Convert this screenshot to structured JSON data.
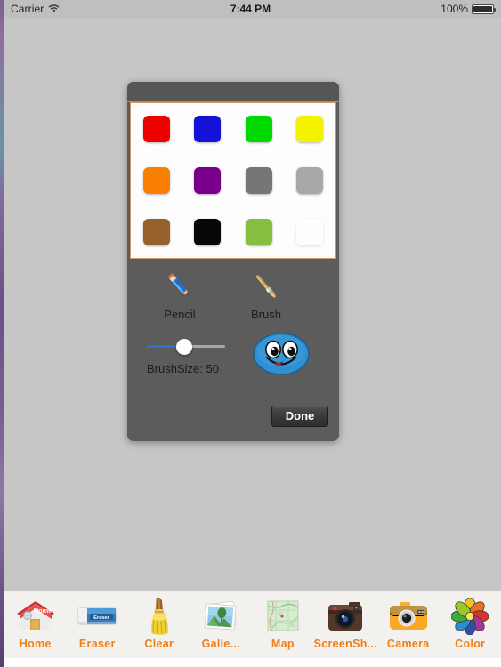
{
  "status_bar": {
    "carrier": "Carrier",
    "wifi_icon": "wifi-icon",
    "time": "7:44 PM",
    "battery_percent": "100%",
    "battery_icon": "battery-full-icon"
  },
  "dialog": {
    "title": "",
    "palette": {
      "swatches": [
        {
          "name": "red",
          "hex": "#ee0000"
        },
        {
          "name": "blue",
          "hex": "#1313d8"
        },
        {
          "name": "green",
          "hex": "#00d900"
        },
        {
          "name": "yellow",
          "hex": "#f3f300"
        },
        {
          "name": "orange",
          "hex": "#f98000"
        },
        {
          "name": "purple",
          "hex": "#7b0089"
        },
        {
          "name": "dark-gray",
          "hex": "#767676"
        },
        {
          "name": "light-gray",
          "hex": "#a8a8a8"
        },
        {
          "name": "brown",
          "hex": "#96602c"
        },
        {
          "name": "black",
          "hex": "#070707"
        },
        {
          "name": "lime",
          "hex": "#84bf41"
        },
        {
          "name": "white",
          "hex": "#fefefe"
        }
      ]
    },
    "tools": [
      {
        "name": "pencil",
        "label": "Pencil",
        "icon": "pencil-icon"
      },
      {
        "name": "brush",
        "label": "Brush",
        "icon": "brush-icon"
      }
    ],
    "brush_size": {
      "label": "BrushSize: 50",
      "value": 50,
      "min": 0,
      "max": 100,
      "fill_color": "#2f6fd0",
      "track_color": "#a8a8a8"
    },
    "smiley": {
      "name": "blue-smiley-face",
      "body_color": "#2f8fd0",
      "tongue_color": "#d8322c"
    },
    "done_button": "Done"
  },
  "bottom_toolbar": {
    "accent_color": "#ef7f19",
    "items": [
      {
        "name": "home",
        "label": "Home",
        "icon": "house-icon"
      },
      {
        "name": "eraser",
        "label": "Eraser",
        "icon": "eraser-icon"
      },
      {
        "name": "clear",
        "label": "Clear",
        "icon": "broom-icon"
      },
      {
        "name": "gallery",
        "label": "Galle...",
        "icon": "photos-icon"
      },
      {
        "name": "map",
        "label": "Map",
        "icon": "map-icon"
      },
      {
        "name": "screenshot",
        "label": "ScreenSh...",
        "icon": "retro-camera-icon"
      },
      {
        "name": "camera",
        "label": "Camera",
        "icon": "camera-icon"
      },
      {
        "name": "color",
        "label": "Color",
        "icon": "color-flower-icon"
      }
    ]
  }
}
